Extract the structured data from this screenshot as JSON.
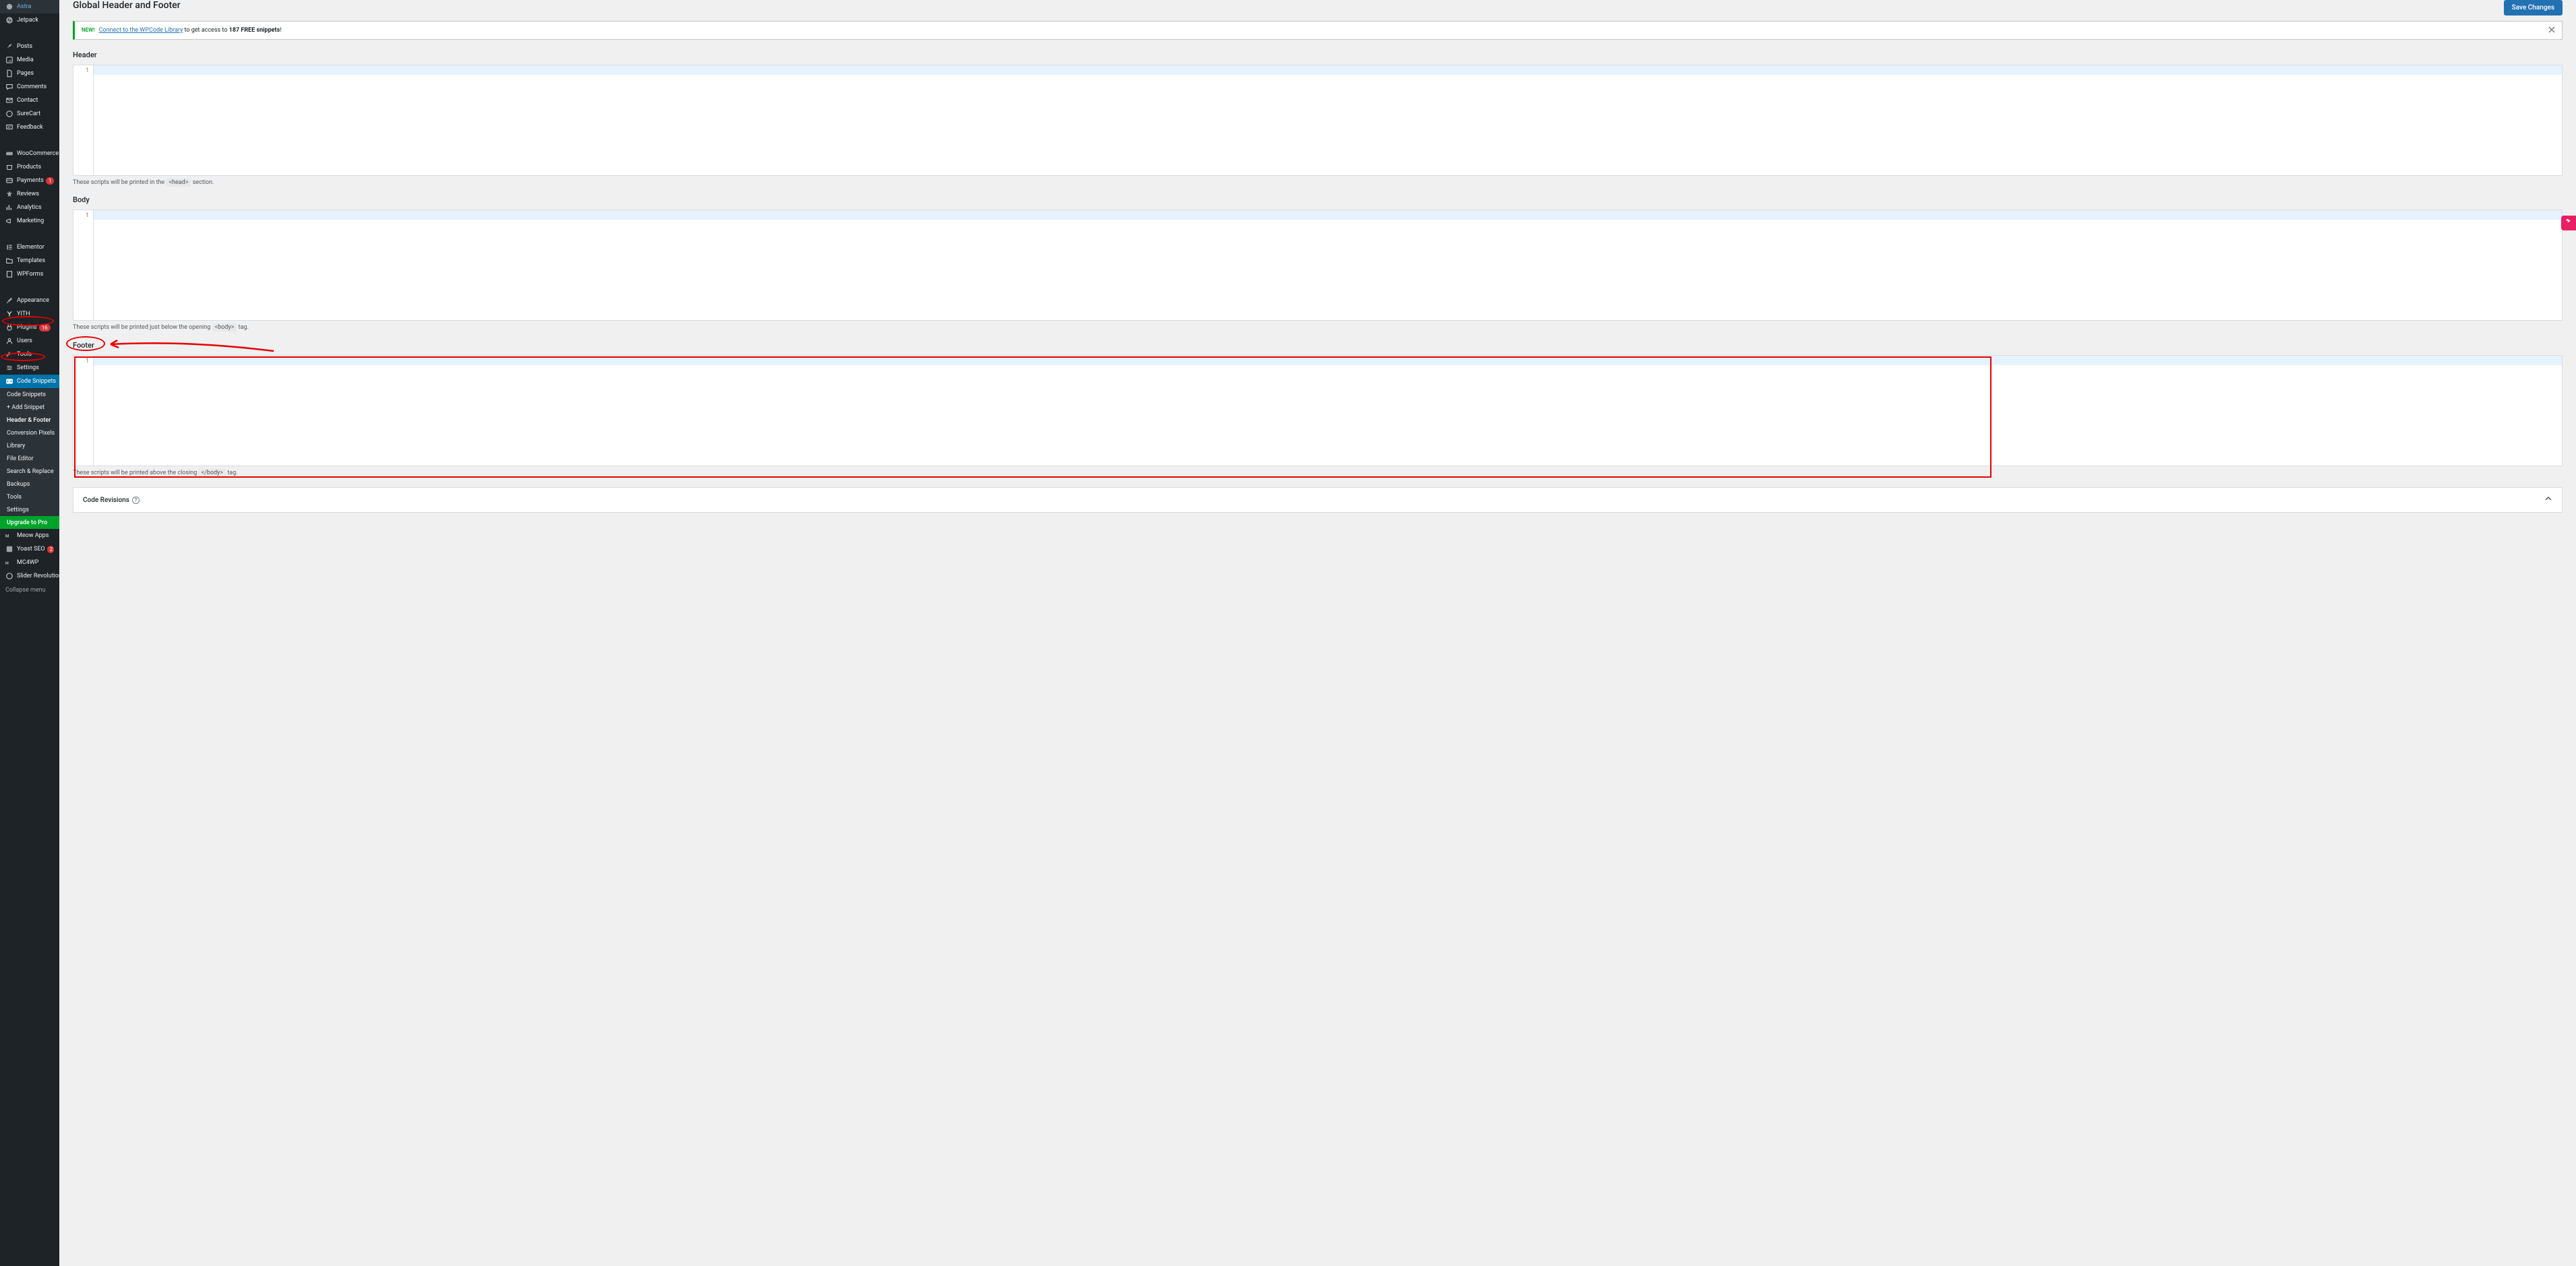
{
  "sidebar": {
    "items": [
      {
        "label": "Astra",
        "icon": "astra"
      },
      {
        "label": "Jetpack",
        "icon": "jetpack"
      },
      {
        "label": "Posts",
        "icon": "pin"
      },
      {
        "label": "Media",
        "icon": "media"
      },
      {
        "label": "Pages",
        "icon": "page"
      },
      {
        "label": "Comments",
        "icon": "comment"
      },
      {
        "label": "Contact",
        "icon": "mail"
      },
      {
        "label": "SureCart",
        "icon": "surecart"
      },
      {
        "label": "Feedback",
        "icon": "feedback"
      },
      {
        "label": "WooCommerce",
        "icon": "woo"
      },
      {
        "label": "Products",
        "icon": "product"
      },
      {
        "label": "Payments",
        "icon": "payment",
        "badge": "1"
      },
      {
        "label": "Reviews",
        "icon": "star"
      },
      {
        "label": "Analytics",
        "icon": "bars"
      },
      {
        "label": "Marketing",
        "icon": "megaphone"
      },
      {
        "label": "Elementor",
        "icon": "elementor"
      },
      {
        "label": "Templates",
        "icon": "folder"
      },
      {
        "label": "WPForms",
        "icon": "wpforms"
      },
      {
        "label": "Appearance",
        "icon": "brush"
      },
      {
        "label": "YITH",
        "icon": "yith"
      },
      {
        "label": "Plugins",
        "icon": "plugin",
        "badge": "16"
      },
      {
        "label": "Users",
        "icon": "user"
      },
      {
        "label": "Tools",
        "icon": "wrench"
      },
      {
        "label": "Settings",
        "icon": "settings"
      },
      {
        "label": "Code Snippets",
        "icon": "code",
        "active": true
      },
      {
        "label": "Meow Apps",
        "icon": "meow"
      },
      {
        "label": "Yoast SEO",
        "icon": "yoast",
        "badge": "2"
      },
      {
        "label": "MC4WP",
        "icon": "mc4wp"
      },
      {
        "label": "Slider Revolution",
        "icon": "slider"
      }
    ],
    "submenu": [
      {
        "label": "Code Snippets"
      },
      {
        "label": "+ Add Snippet"
      },
      {
        "label": "Header & Footer",
        "active": true
      },
      {
        "label": "Conversion Pixels"
      },
      {
        "label": "Library"
      },
      {
        "label": "File Editor"
      },
      {
        "label": "Search & Replace"
      },
      {
        "label": "Backups"
      },
      {
        "label": "Tools"
      },
      {
        "label": "Settings"
      }
    ],
    "upgrade_label": "Upgrade to Pro",
    "collapse_label": "Collapse menu"
  },
  "page": {
    "title": "Global Header and Footer",
    "save_button": "Save Changes"
  },
  "notice": {
    "new_tag": "NEW!",
    "link_text": "Connect to the WPCode Library",
    "text_mid": " to get access to ",
    "bold": "187 FREE snippets",
    "text_end": "!"
  },
  "sections": {
    "header": {
      "title": "Header",
      "help_pre": "These scripts will be printed in the ",
      "help_code": "<head>",
      "help_post": " section."
    },
    "body": {
      "title": "Body",
      "help_pre": "These scripts will be printed just below the opening ",
      "help_code": "<body>",
      "help_post": " tag."
    },
    "footer": {
      "title": "Footer",
      "help_pre": "These scripts will be printed above the closing ",
      "help_code": "</body>",
      "help_post": " tag."
    }
  },
  "revisions": {
    "title": "Code Revisions"
  },
  "editor_line": "1"
}
